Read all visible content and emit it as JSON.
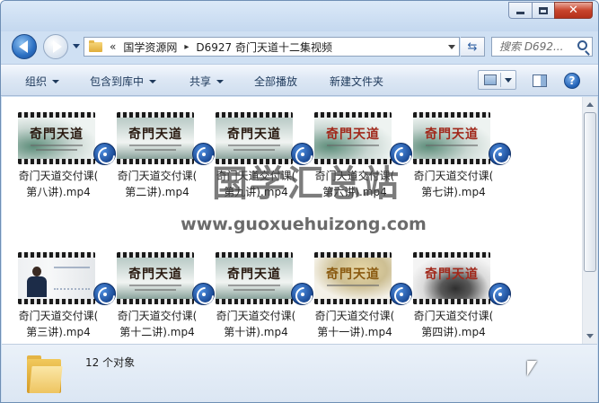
{
  "address": {
    "chevron": "«",
    "separator": "▸",
    "crumbs": [
      "国学资源网",
      "D6927 奇门天道十二集视频"
    ],
    "search_placeholder": "搜索 D692...",
    "refresh_glyph": "⇆"
  },
  "toolbar": {
    "organize": "组织",
    "include_in_library": "包含到库中",
    "share": "共享",
    "play_all": "全部播放",
    "new_folder": "新建文件夹",
    "help": "?"
  },
  "window": {
    "close_glyph": "✕"
  },
  "files": [
    {
      "line1": "奇门天道交付课(",
      "line2": "第八讲).mp4",
      "thumb": "奇門天道"
    },
    {
      "line1": "奇门天道交付课(",
      "line2": "第二讲).mp4",
      "thumb": "奇門天道"
    },
    {
      "line1": "奇门天道交付课(",
      "line2": "第九讲).mp4",
      "thumb": "奇門天道"
    },
    {
      "line1": "奇门天道交付课(",
      "line2": "第六讲).mp4",
      "thumb": "奇門天道"
    },
    {
      "line1": "奇门天道交付课(",
      "line2": "第七讲).mp4",
      "thumb": "奇門天道"
    },
    {
      "line1": "奇门天道交付课(",
      "line2": "第三讲).mp4",
      "thumb": ""
    },
    {
      "line1": "奇门天道交付课(",
      "line2": "第十二讲).mp4",
      "thumb": "奇門天道"
    },
    {
      "line1": "奇门天道交付课(",
      "line2": "第十讲).mp4",
      "thumb": "奇門天道"
    },
    {
      "line1": "奇门天道交付课(",
      "line2": "第十一讲).mp4",
      "thumb": "奇門天道"
    },
    {
      "line1": "奇门天道交付课(",
      "line2": "第四讲).mp4",
      "thumb": "奇門天道"
    }
  ],
  "watermark": {
    "cn": "国学汇总站",
    "url": "www.guoxuehuizong.com"
  },
  "details": {
    "count": "12 个对象"
  },
  "colors": {
    "accent": "#1f5fb5",
    "close": "#c8452c",
    "toolbar_text": "#1e395b"
  }
}
